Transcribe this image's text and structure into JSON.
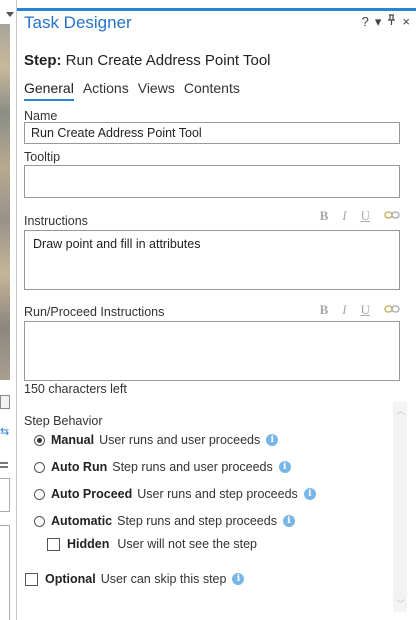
{
  "pane": {
    "title": "Task Designer",
    "controls": {
      "help": "?",
      "menu": "▾",
      "pin": "ᵾ",
      "close": "×"
    }
  },
  "step": {
    "prefix": "Step:",
    "name": "Run Create Address Point Tool"
  },
  "tabs": [
    {
      "label": "General",
      "active": true
    },
    {
      "label": "Actions",
      "active": false
    },
    {
      "label": "Views",
      "active": false
    },
    {
      "label": "Contents",
      "active": false
    }
  ],
  "fields": {
    "name_label": "Name",
    "name_value": "Run Create Address Point Tool",
    "tooltip_label": "Tooltip",
    "tooltip_value": "",
    "instructions_label": "Instructions",
    "instructions_value": "Draw point and fill in attributes",
    "run_proceed_label": "Run/Proceed Instructions",
    "run_proceed_value": "",
    "chars_left": "150 characters left"
  },
  "format_toolbar": {
    "bold": "B",
    "italic": "I",
    "underline": "U"
  },
  "behavior": {
    "label": "Step Behavior",
    "options": [
      {
        "title": "Manual",
        "desc": "User runs and user proceeds",
        "selected": true
      },
      {
        "title": "Auto Run",
        "desc": "Step runs and user proceeds",
        "selected": false
      },
      {
        "title": "Auto Proceed",
        "desc": "User runs and step proceeds",
        "selected": false
      },
      {
        "title": "Automatic",
        "desc": "Step runs and step proceeds",
        "selected": false
      }
    ],
    "hidden": {
      "title": "Hidden",
      "desc": "User will not see the step",
      "checked": false
    },
    "optional": {
      "title": "Optional",
      "desc": "User can skip this step",
      "checked": false
    }
  },
  "icons": {
    "info": "i",
    "link": "link-icon"
  },
  "colors": {
    "accent": "#2b83d4",
    "title": "#2474c8",
    "info": "#79b6e8"
  }
}
